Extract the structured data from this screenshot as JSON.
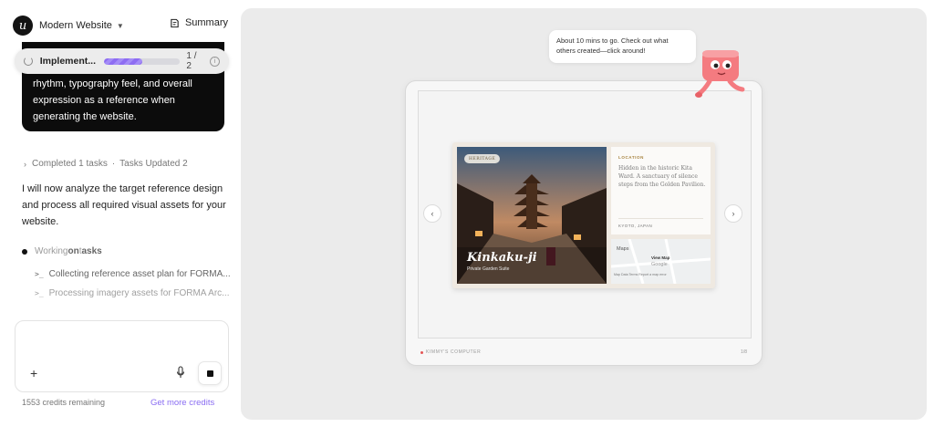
{
  "header": {
    "logo_glyph": "u",
    "project_title": "Modern Website",
    "summary_label": "Summary"
  },
  "progress": {
    "label": "Implement...",
    "count": "1 / 2",
    "fraction": 0.5
  },
  "instruction_card": {
    "text": "rhythm, typography feel, and overall expression as a reference when generating the website."
  },
  "status": {
    "completed": "Completed 1 tasks",
    "separator": "·",
    "updated": "Tasks Updated 2"
  },
  "message": "I will now analyze the target reference design and process all required visual assets for your website.",
  "working": {
    "prefix": "Working ",
    "on": "on",
    "t": " t",
    "asks": "asks"
  },
  "tasks": [
    "Collecting reference asset plan for FORMA...",
    "Processing imagery assets for FORMA Arc..."
  ],
  "composer": {
    "plus": "+",
    "credits": "1553 credits remaining",
    "get_more": "Get more credits"
  },
  "preview": {
    "bubble": "About 10 mins to go. Check out what others created—click around!",
    "device_label": "KIMMY'S COMPUTER",
    "device_num": "1/8",
    "nav_prev": "‹",
    "nav_next": "›",
    "site": {
      "badge": "HERITAGE",
      "title": "Kinkaku-ji",
      "subtitle": "Private Garden Suite",
      "location_label": "LOCATION",
      "location_text": "Hidden in the historic Kita Ward. A sanctuary of silence steps from the Golden Pavilion.",
      "place": "KYOTO, JAPAN",
      "maps_label": "Maps",
      "view_map": "View Map",
      "google": "Google",
      "map_footer": "Map Data   Terms   Report a map error"
    }
  },
  "colors": {
    "accent": "#8a6df2",
    "preview_bg": "#ebebeb",
    "card_black": "#0c0c0c",
    "gold": "#a6823d"
  }
}
